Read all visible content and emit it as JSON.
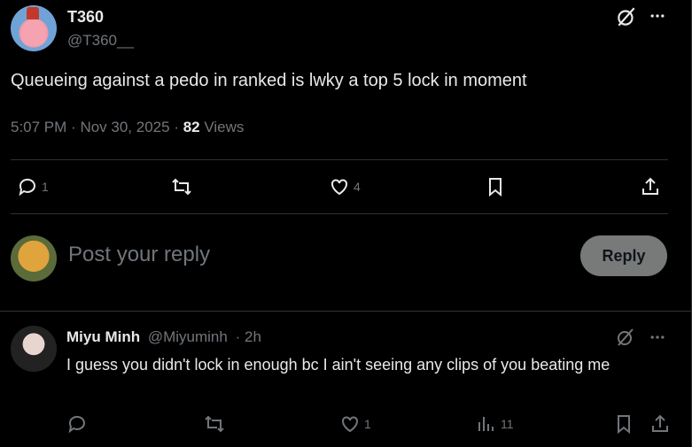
{
  "tweet": {
    "author_name": "T360",
    "author_handle": "@T360__",
    "text": "Queueing against a pedo in ranked is lwky a top 5 lock in moment",
    "time": "5:07 PM",
    "date": "Nov 30, 2025",
    "views_count": "82",
    "views_label": "Views",
    "replies": "1",
    "likes": "4"
  },
  "reply_box": {
    "placeholder": "Post your reply",
    "button_label": "Reply"
  },
  "reply": {
    "author_name": "Miyu Minh",
    "author_handle": "@Miyuminh",
    "time": "2h",
    "text": "I guess you didn't lock in enough bc I ain't seeing any clips of you beating me",
    "likes": "1",
    "views": "11"
  },
  "icons": [
    "grok-icon",
    "more-icon",
    "reply-icon",
    "retweet-icon",
    "like-icon",
    "bookmark-icon",
    "share-icon",
    "views-icon"
  ]
}
